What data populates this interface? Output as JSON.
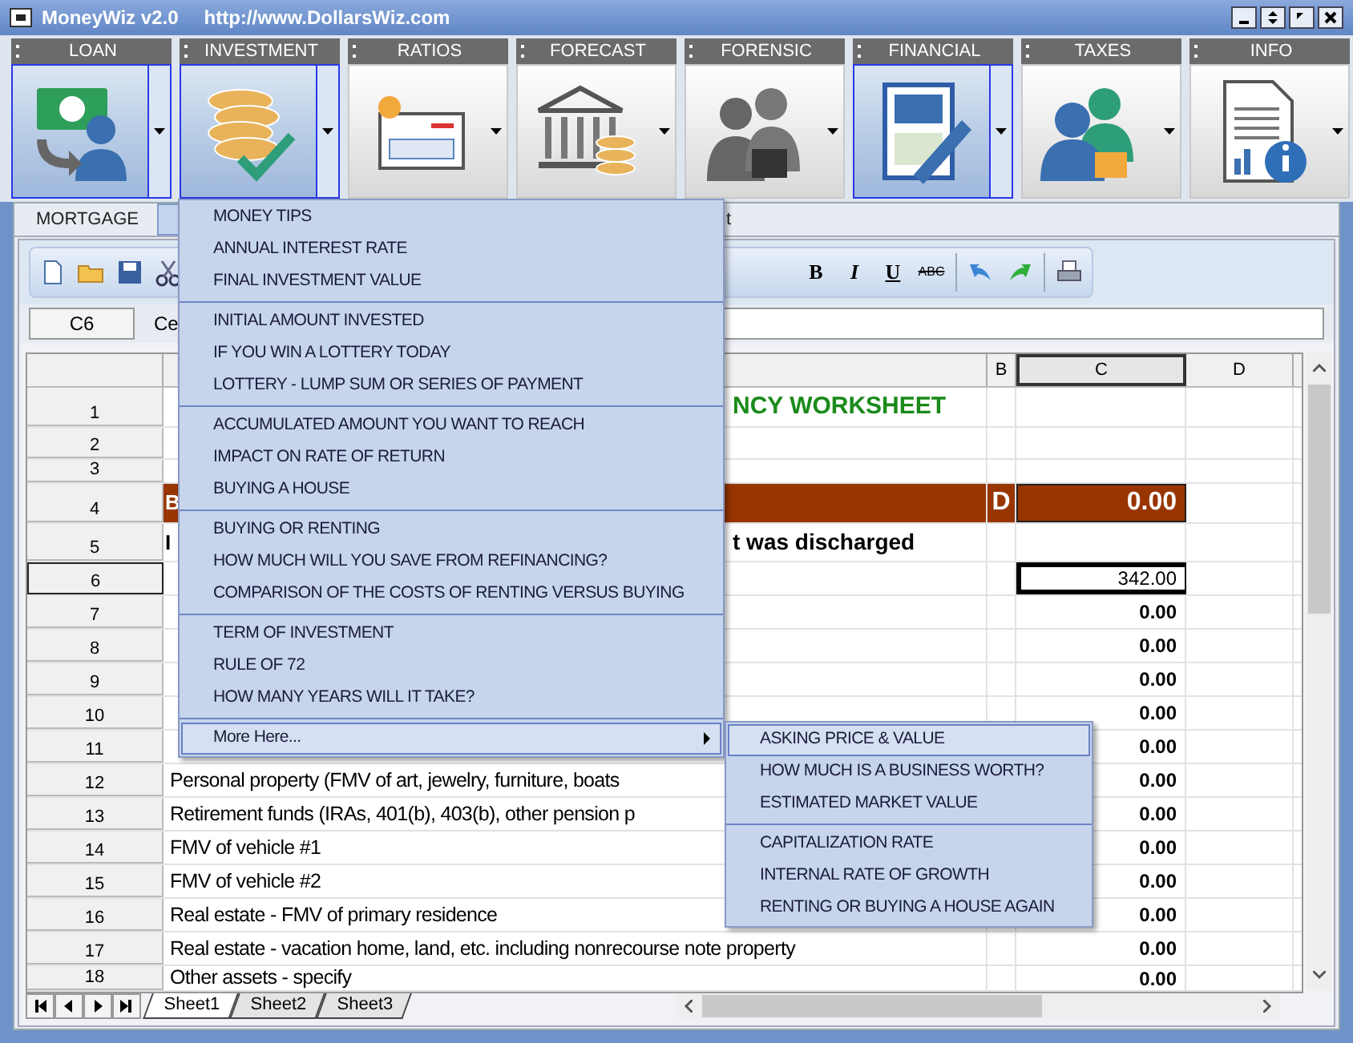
{
  "window": {
    "title": "MoneyWiz v2.0",
    "url": "http://www.DollarsWiz.com"
  },
  "ribbon": [
    {
      "label": "LOAN",
      "selected": true
    },
    {
      "label": "INVESTMENT",
      "selected": true
    },
    {
      "label": "RATIOS",
      "selected": false
    },
    {
      "label": "FORECAST",
      "selected": false
    },
    {
      "label": "FORENSIC",
      "selected": false
    },
    {
      "label": "FINANCIAL",
      "selected": true
    },
    {
      "label": "TAXES",
      "selected": false
    },
    {
      "label": "INFO",
      "selected": false
    }
  ],
  "tabs": [
    {
      "label": "MORTGAGE",
      "selected": false
    },
    {
      "selected": true
    },
    {
      "label": "t",
      "selected": false
    }
  ],
  "format_buttons": [
    "B",
    "I",
    "U",
    "ABC"
  ],
  "name_box": "C6",
  "formula_label": "Ce",
  "columns": [
    {
      "label": "B",
      "selected": false
    },
    {
      "label": "C",
      "selected": true
    },
    {
      "label": "D",
      "selected": false
    }
  ],
  "rows": [
    {
      "number": "1",
      "kind": "title",
      "a_right": "NCY WORKSHEET",
      "selected": false
    },
    {
      "number": "2",
      "kind": "plain",
      "selected": false
    },
    {
      "number": "3",
      "kind": "plain",
      "selected": false
    },
    {
      "number": "4",
      "kind": "band",
      "a": "B",
      "b": "D",
      "c": "0.00",
      "selected": false
    },
    {
      "number": "5",
      "kind": "heading",
      "a": "I",
      "a_right": "t was discharged",
      "selected": false
    },
    {
      "number": "6",
      "kind": "plain",
      "c": "342.00",
      "selected": true
    },
    {
      "number": "7",
      "kind": "plain",
      "c": "0.00",
      "selected": false
    },
    {
      "number": "8",
      "kind": "plain",
      "c": "0.00",
      "selected": false
    },
    {
      "number": "9",
      "kind": "plain",
      "c": "0.00",
      "selected": false
    },
    {
      "number": "10",
      "kind": "plain",
      "c": "0.00",
      "selected": false
    },
    {
      "number": "11",
      "kind": "plain",
      "c": "0.00",
      "selected": false
    },
    {
      "number": "12",
      "kind": "plain",
      "a": "Personal property (FMV of art, jewelry, furniture, boats",
      "c": "0.00",
      "selected": false
    },
    {
      "number": "13",
      "kind": "plain",
      "a": "Retirement funds (IRAs, 401(b), 403(b), other pension p",
      "c": "0.00",
      "selected": false
    },
    {
      "number": "14",
      "kind": "plain",
      "a": "FMV of vehicle #1",
      "c": "0.00",
      "selected": false
    },
    {
      "number": "15",
      "kind": "plain",
      "a": "FMV of vehicle #2",
      "c": "0.00",
      "selected": false
    },
    {
      "number": "16",
      "kind": "plain",
      "a": "Real estate - FMV of primary residence",
      "c": "0.00",
      "selected": false
    },
    {
      "number": "17",
      "kind": "plain",
      "a": "Real estate - vacation home, land, etc. including nonrecourse note property",
      "c": "0.00",
      "selected": false
    },
    {
      "number": "18",
      "kind": "plain",
      "a": "Other assets - specify",
      "c": "0.00",
      "selected": false
    }
  ],
  "sheet_tabs": [
    {
      "label": "Sheet1",
      "selected": true
    },
    {
      "label": "Sheet2",
      "selected": false
    },
    {
      "label": "Sheet3",
      "selected": false
    }
  ],
  "menu": {
    "groups": [
      [
        {
          "label": "MONEY TIPS",
          "selected": false
        },
        {
          "label": "ANNUAL INTEREST RATE",
          "selected": false
        },
        {
          "label": "FINAL INVESTMENT VALUE",
          "selected": false
        }
      ],
      [
        {
          "label": "INITIAL AMOUNT INVESTED",
          "selected": false
        },
        {
          "label": "IF YOU WIN A LOTTERY TODAY",
          "selected": false
        },
        {
          "label": "LOTTERY - LUMP SUM OR SERIES OF PAYMENT",
          "selected": false
        }
      ],
      [
        {
          "label": "ACCUMULATED AMOUNT YOU WANT TO REACH",
          "selected": false
        },
        {
          "label": "IMPACT ON RATE OF RETURN",
          "selected": false
        },
        {
          "label": "BUYING A HOUSE",
          "selected": false
        }
      ],
      [
        {
          "label": "BUYING OR RENTING",
          "selected": false
        },
        {
          "label": "HOW MUCH WILL YOU SAVE FROM REFINANCING?",
          "selected": false
        },
        {
          "label": "COMPARISON OF THE COSTS OF RENTING VERSUS BUYING",
          "selected": false
        }
      ],
      [
        {
          "label": "TERM OF INVESTMENT",
          "selected": false
        },
        {
          "label": "RULE OF 72",
          "selected": false
        },
        {
          "label": "HOW MANY YEARS WILL IT TAKE?",
          "selected": false
        }
      ],
      [
        {
          "label": "More Here...",
          "selected": true,
          "kind": "submenu"
        }
      ]
    ]
  },
  "submenu": {
    "groups": [
      [
        {
          "label": "ASKING PRICE & VALUE",
          "selected": true
        },
        {
          "label": "HOW MUCH IS A BUSINESS WORTH?",
          "selected": false
        },
        {
          "label": "ESTIMATED MARKET VALUE",
          "selected": false
        }
      ],
      [
        {
          "label": "CAPITALIZATION RATE",
          "selected": false
        },
        {
          "label": "INTERNAL RATE OF GROWTH",
          "selected": false
        },
        {
          "label": "RENTING OR BUYING A HOUSE AGAIN",
          "selected": false
        }
      ]
    ]
  }
}
